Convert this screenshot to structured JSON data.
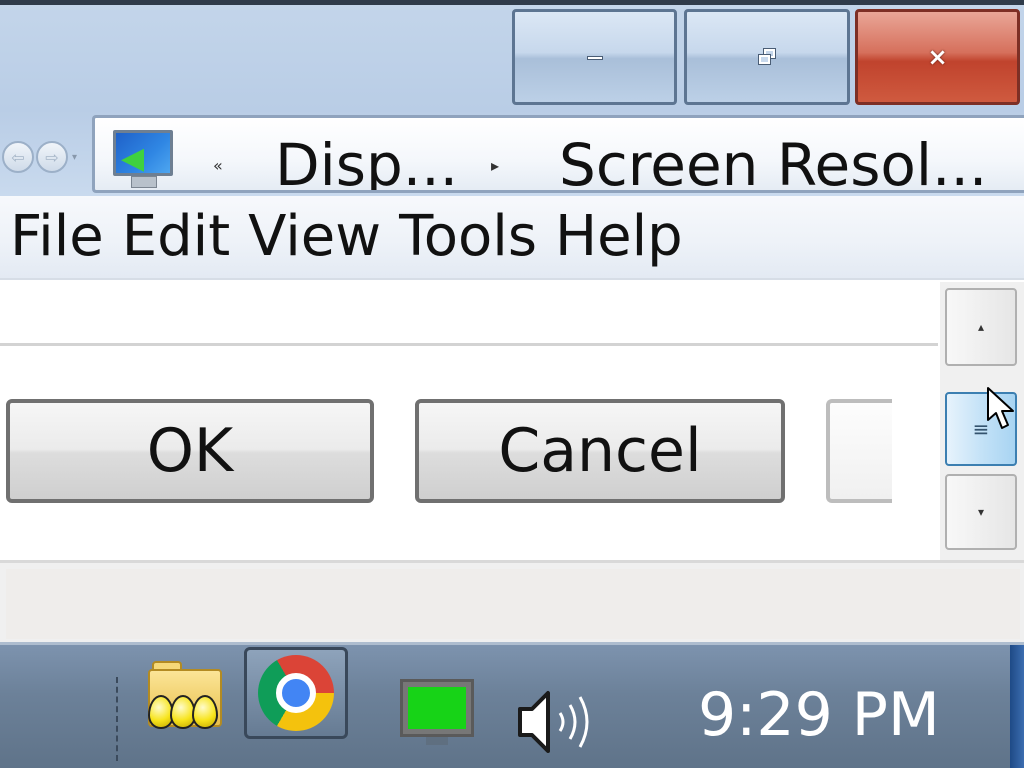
{
  "window": {
    "minimize_label": "",
    "maximize_label": "",
    "close_glyph": "×"
  },
  "nav": {
    "back_glyph": "⇦",
    "forward_glyph": "⇨",
    "dropdown_glyph": "▾"
  },
  "address": {
    "icon": "display-settings-icon",
    "overflow_glyph": "«",
    "separator_glyph": "▸",
    "crumbs": [
      "Disp...",
      "Screen Resol..."
    ]
  },
  "menu": {
    "items": [
      "File",
      "Edit",
      "View",
      "Tools",
      "Help"
    ]
  },
  "dialog": {
    "ok_label": "OK",
    "cancel_label": "Cancel"
  },
  "scrollbar": {
    "up_glyph": "▴",
    "thumb_glyph": "≡",
    "down_glyph": "▾"
  },
  "taskbar": {
    "icons": [
      "folder-icon",
      "chrome-icon",
      "monitor-icon",
      "speaker-icon"
    ],
    "clock": "9:29 PM"
  },
  "colors": {
    "close_red": "#c0432d",
    "monitor_green": "#17d317",
    "taskbar": "#6c8199",
    "thumb_blue": "#3c7fb1"
  }
}
